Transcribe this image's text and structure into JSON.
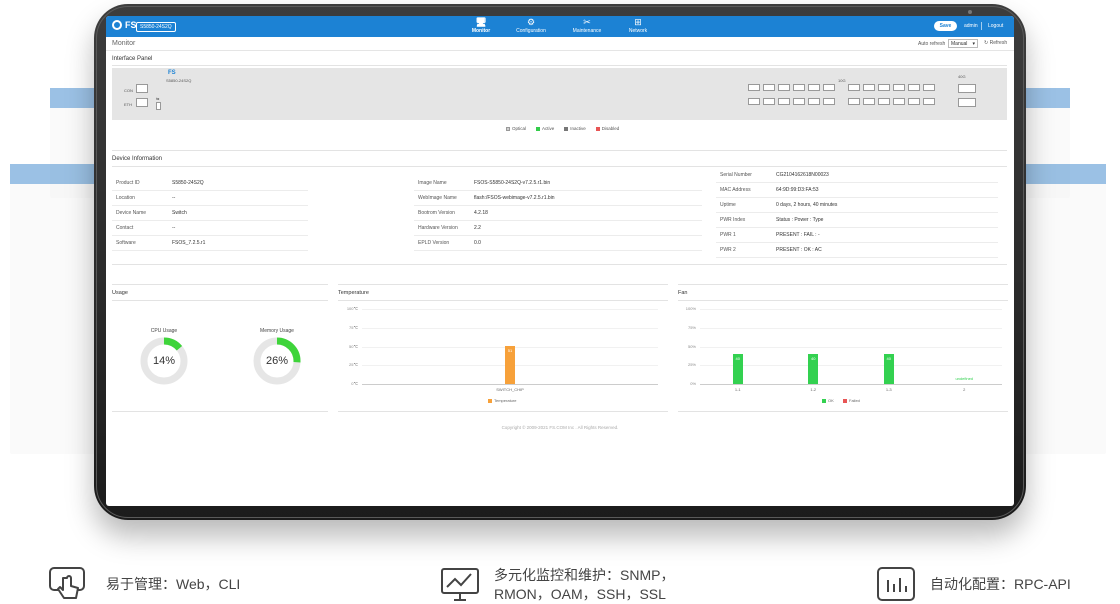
{
  "app": {
    "brand": "FS",
    "model": "S5850-24S2Q",
    "nav": [
      {
        "label": "Monitor",
        "icon": "monitor-icon",
        "active": true
      },
      {
        "label": "Configuration",
        "icon": "gear-icon",
        "active": false
      },
      {
        "label": "Maintenance",
        "icon": "tools-icon",
        "active": false
      },
      {
        "label": "Network",
        "icon": "network-icon",
        "active": false
      }
    ],
    "save_label": "Save",
    "user": "admin",
    "logout_label": "Logout"
  },
  "monitor": {
    "title": "Monitor",
    "auto_refresh_label": "Auto refresh",
    "auto_refresh_value": "Manual",
    "refresh_label": "Refresh"
  },
  "interface_panel": {
    "title": "Interface Panel",
    "model": "S5850-24S2Q",
    "con_label": "CON",
    "eth_label": "ETH",
    "sfp_label": "10G",
    "qsfp_label": "40G",
    "legend": [
      {
        "label": "Optical",
        "color": "#cfcfcf"
      },
      {
        "label": "Active",
        "color": "#33cc4a"
      },
      {
        "label": "Inactive",
        "color": "#777777"
      },
      {
        "label": "Disabled",
        "color": "#e85555"
      }
    ]
  },
  "device_info": {
    "title": "Device Information",
    "col1": [
      {
        "k": "Product ID",
        "v": "S5850-24S2Q"
      },
      {
        "k": "Location",
        "v": "--"
      },
      {
        "k": "Device Name",
        "v": "Switch"
      },
      {
        "k": "Contact",
        "v": "--"
      },
      {
        "k": "Software",
        "v": "FSOS_7.2.5.r1"
      }
    ],
    "col2": [
      {
        "k": "Image Name",
        "v": "FSOS-S5850-24S2Q-v7.2.5.r1.bin"
      },
      {
        "k": "WebImage Name",
        "v": "flash:/FSOS-webimage-v7.2.5.r1.bin"
      },
      {
        "k": "Bootrom Version",
        "v": "4.2.18"
      },
      {
        "k": "Hardware Version",
        "v": "2.2"
      },
      {
        "k": "EPLD Version",
        "v": "0.0"
      }
    ],
    "col3": [
      {
        "k": "Serial Number",
        "v": "CG2104162618N00023"
      },
      {
        "k": "MAC Address",
        "v": "64:9D:99:D3:FA:53"
      },
      {
        "k": "Uptime",
        "v": "0 days, 2 hours, 40 minutes"
      },
      {
        "k": "PWR Index",
        "v": "Status : Power : Type"
      },
      {
        "k": "PWR 1",
        "v": "PRESENT : FAIL : -"
      },
      {
        "k": "PWR 2",
        "v": "PRESENT : OK : AC"
      }
    ]
  },
  "usage": {
    "title": "Usage",
    "cpu_label": "CPU Usage",
    "cpu_value": 14,
    "cpu_text": "14%",
    "mem_label": "Memory Usage",
    "mem_value": 26,
    "mem_text": "26%"
  },
  "temperature": {
    "title": "Temperature",
    "ticks": [
      "100℃",
      "75℃",
      "50℃",
      "25℃",
      "0℃"
    ],
    "legend": "Temperature",
    "colors": {
      "bar": "#f7a13a"
    }
  },
  "fan": {
    "title": "Fan",
    "ticks": [
      "100%",
      "75%",
      "50%",
      "25%",
      "0%"
    ],
    "legend_ok": "OK",
    "legend_failed": "Failed",
    "colors": {
      "ok": "#33d150",
      "failed": "#e85555"
    }
  },
  "chart_data": [
    {
      "type": "bar",
      "title": "Temperature",
      "categories": [
        "SWITCH_CHIP"
      ],
      "values": [
        51
      ],
      "bar_labels": [
        "51"
      ],
      "ylim": [
        0,
        100
      ],
      "yticks": [
        "0℃",
        "25℃",
        "50℃",
        "75℃",
        "100℃"
      ],
      "legend": [
        "Temperature"
      ]
    },
    {
      "type": "bar",
      "title": "Fan",
      "categories": [
        "1-1",
        "1-2",
        "1-3",
        "2"
      ],
      "values": [
        40,
        40,
        40,
        0
      ],
      "bar_labels": [
        "40",
        "40",
        "40",
        "undefined"
      ],
      "ylim": [
        0,
        100
      ],
      "yticks": [
        "0%",
        "25%",
        "50%",
        "75%",
        "100%"
      ],
      "legend": [
        "OK",
        "Failed"
      ]
    }
  ],
  "footer": "Copyright © 2009-2021 FS.COM Inc . All Rights Reserved.",
  "features": [
    {
      "icon": "touch-icon",
      "text": "易于管理：Web，CLI"
    },
    {
      "icon": "monitor-chart-icon",
      "text": "多元化监控和维护：SNMP，RMON，OAM，SSH，SSL"
    },
    {
      "icon": "bar-chart-icon",
      "text": "自动化配置：RPC-API"
    }
  ]
}
